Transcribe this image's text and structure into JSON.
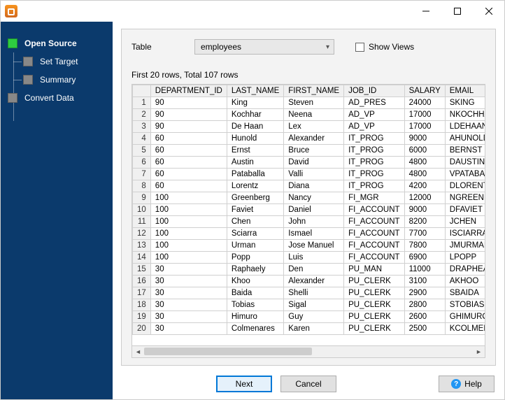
{
  "sidebar": {
    "items": [
      {
        "label": "Open Source",
        "active": true,
        "child": false
      },
      {
        "label": "Set Target",
        "active": false,
        "child": true
      },
      {
        "label": "Summary",
        "active": false,
        "child": true
      },
      {
        "label": "Convert Data",
        "active": false,
        "child": false
      }
    ]
  },
  "panel": {
    "table_label": "Table",
    "table_selected": "employees",
    "show_views_label": "Show Views",
    "counts_text": "First 20 rows, Total 107 rows"
  },
  "table": {
    "columns": [
      "DEPARTMENT_ID",
      "LAST_NAME",
      "FIRST_NAME",
      "JOB_ID",
      "SALARY",
      "EMAIL"
    ],
    "rows": [
      [
        "90",
        "King",
        "Steven",
        "AD_PRES",
        "24000",
        "SKING"
      ],
      [
        "90",
        "Kochhar",
        "Neena",
        "AD_VP",
        "17000",
        "NKOCHHAR"
      ],
      [
        "90",
        "De Haan",
        "Lex",
        "AD_VP",
        "17000",
        "LDEHAAN"
      ],
      [
        "60",
        "Hunold",
        "Alexander",
        "IT_PROG",
        "9000",
        "AHUNOLD"
      ],
      [
        "60",
        "Ernst",
        "Bruce",
        "IT_PROG",
        "6000",
        "BERNST"
      ],
      [
        "60",
        "Austin",
        "David",
        "IT_PROG",
        "4800",
        "DAUSTIN"
      ],
      [
        "60",
        "Pataballa",
        "Valli",
        "IT_PROG",
        "4800",
        "VPATABAL"
      ],
      [
        "60",
        "Lorentz",
        "Diana",
        "IT_PROG",
        "4200",
        "DLORENTZ"
      ],
      [
        "100",
        "Greenberg",
        "Nancy",
        "FI_MGR",
        "12000",
        "NGREENBE"
      ],
      [
        "100",
        "Faviet",
        "Daniel",
        "FI_ACCOUNT",
        "9000",
        "DFAVIET"
      ],
      [
        "100",
        "Chen",
        "John",
        "FI_ACCOUNT",
        "8200",
        "JCHEN"
      ],
      [
        "100",
        "Sciarra",
        "Ismael",
        "FI_ACCOUNT",
        "7700",
        "ISCIARRA"
      ],
      [
        "100",
        "Urman",
        "Jose Manuel",
        "FI_ACCOUNT",
        "7800",
        "JMURMAN"
      ],
      [
        "100",
        "Popp",
        "Luis",
        "FI_ACCOUNT",
        "6900",
        "LPOPP"
      ],
      [
        "30",
        "Raphaely",
        "Den",
        "PU_MAN",
        "11000",
        "DRAPHEAL"
      ],
      [
        "30",
        "Khoo",
        "Alexander",
        "PU_CLERK",
        "3100",
        "AKHOO"
      ],
      [
        "30",
        "Baida",
        "Shelli",
        "PU_CLERK",
        "2900",
        "SBAIDA"
      ],
      [
        "30",
        "Tobias",
        "Sigal",
        "PU_CLERK",
        "2800",
        "STOBIAS"
      ],
      [
        "30",
        "Himuro",
        "Guy",
        "PU_CLERK",
        "2600",
        "GHIMURO"
      ],
      [
        "30",
        "Colmenares",
        "Karen",
        "PU_CLERK",
        "2500",
        "KCOLMENA"
      ]
    ]
  },
  "footer": {
    "next_label": "Next",
    "cancel_label": "Cancel",
    "help_label": "Help"
  }
}
